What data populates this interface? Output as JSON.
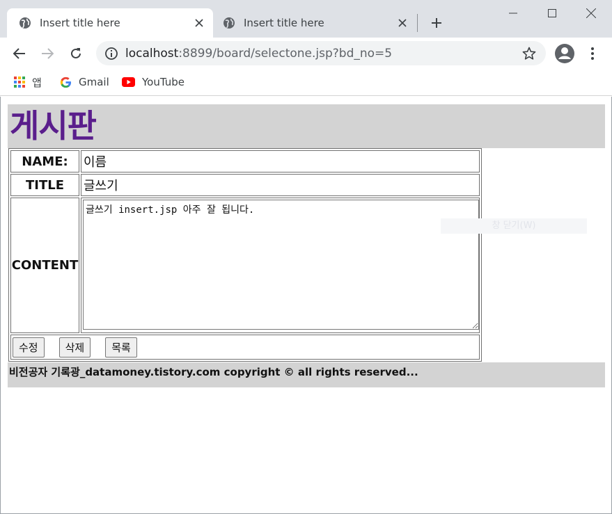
{
  "tabs": [
    {
      "title": "Insert title here",
      "active": true
    },
    {
      "title": "Insert title here",
      "active": false
    }
  ],
  "address": {
    "host": "localhost",
    "path": ":8899/board/selectone.jsp?bd_no=5"
  },
  "bookmarks": [
    {
      "label": "앱",
      "icon": "apps-grid-icon"
    },
    {
      "label": "Gmail",
      "icon": "google-icon"
    },
    {
      "label": "YouTube",
      "icon": "youtube-icon"
    }
  ],
  "page": {
    "heading": "게시판",
    "form": {
      "name_label": "NAME:",
      "name_value": "이름",
      "title_label": "TITLE",
      "title_value": "글쓰기",
      "content_label": "CONTENT",
      "content_value": "글쓰기 insert.jsp 아주 잘 됩니다."
    },
    "buttons": {
      "edit": "수정",
      "delete": "삭제",
      "list": "목록"
    },
    "footer": "비전공자 기록광_datamoney.tistory.com copyright © all rights reserved...",
    "ghost_overlay": "창 닫기(W)"
  },
  "colors": {
    "heading": "#5a1e8c",
    "header_bg": "#d3d3d3",
    "tabstrip_bg": "#dee1e6",
    "omnibox_bg": "#f1f3f4"
  }
}
